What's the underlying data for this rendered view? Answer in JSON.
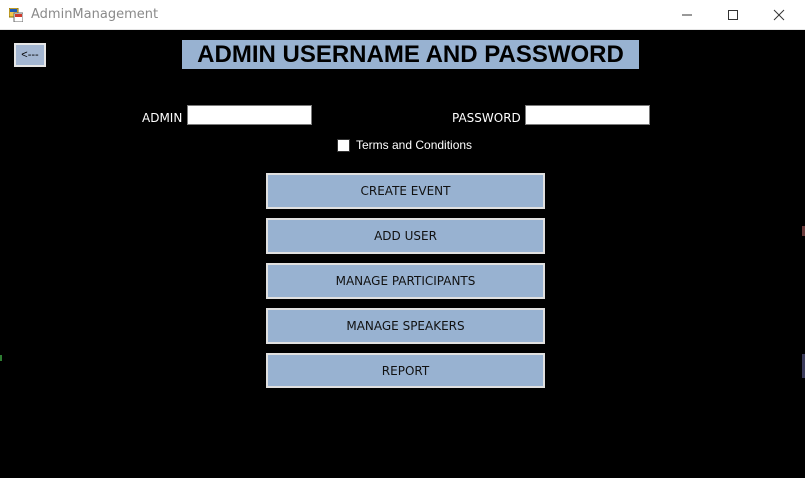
{
  "window": {
    "title": "AdminManagement"
  },
  "header": {
    "back_label": "<---",
    "title": "ADMIN USERNAME AND PASSWORD"
  },
  "login": {
    "admin_label": "ADMIN",
    "admin_value": "",
    "password_label": "PASSWORD",
    "password_value": "",
    "terms_label": "Terms and Conditions"
  },
  "menu": {
    "create_event": "CREATE EVENT",
    "add_user": "ADD USER",
    "manage_participants": "MANAGE PARTICIPANTS",
    "manage_speakers": "MANAGE SPEAKERS",
    "report": "REPORT"
  },
  "colors": {
    "background": "#000000",
    "button_fill": "#98b2d1",
    "title_fill": "#98b2d1"
  }
}
